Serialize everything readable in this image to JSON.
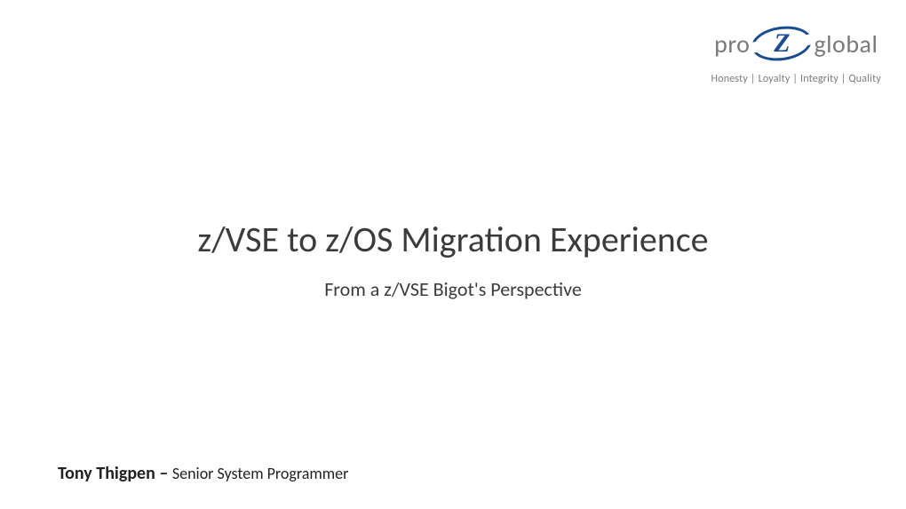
{
  "logo": {
    "left_text": "pro",
    "z_letter": "Z",
    "right_text": "global",
    "tagline": "Honesty | Loyalty | Integrity | Quality"
  },
  "title": {
    "main": "z/VSE to z/OS Migration Experience",
    "subtitle": "From a z/VSE Bigot's Perspective"
  },
  "author": {
    "name": "Tony Thigpen",
    "separator": " – ",
    "role": "Senior System Programmer"
  }
}
